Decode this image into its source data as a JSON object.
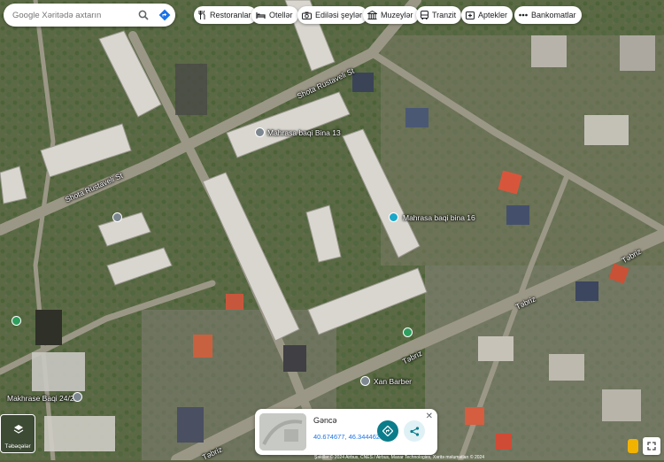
{
  "search": {
    "placeholder": "Google Xəritədə axtarın"
  },
  "categories": [
    {
      "id": "restaurants",
      "label": "Restoranlar",
      "icon": "fork-knife-icon"
    },
    {
      "id": "hotels",
      "label": "Otellər",
      "icon": "bed-icon"
    },
    {
      "id": "attractions",
      "label": "Ediləsi şeylər",
      "icon": "camera-icon"
    },
    {
      "id": "museums",
      "label": "Muzeylər",
      "icon": "museum-icon"
    },
    {
      "id": "transit",
      "label": "Tranzit",
      "icon": "bus-icon"
    },
    {
      "id": "pharmacies",
      "label": "Aptekler",
      "icon": "pharmacy-icon"
    },
    {
      "id": "atms",
      "label": "Bankomatlar",
      "icon": "more-dots-icon"
    }
  ],
  "places": {
    "mahrasa13": "Mahrasa baqi Bina 13",
    "mahrasa16": "Mahrasa baqi bina 16",
    "xan_barber": "Xan Barber",
    "makhrase": "Makhrase Baqi 24/2"
  },
  "streets": {
    "rustaveli_1": "Shota Rustaveli St",
    "rustaveli_2": "Shota Rustaveli St",
    "tebriz_1": "Təbriz",
    "tebriz_2": "Təbriz",
    "tebriz_3": "Təbriz",
    "tebriz_4": "Təbriz"
  },
  "layers": {
    "label": "Təbəqələr"
  },
  "place_card": {
    "title": "Gəncə",
    "coordinates": "40.674677, 46.344462"
  },
  "attribution": "Şəkillər © 2024 Airbus, CNES / Airbus, Maxar Technologies, Xəritə məlumatları © 2024",
  "colors": {
    "direction_button": "#0b7c8a",
    "pin_cyan": "#1ba7c9",
    "pin_green": "#2e9f5e",
    "pin_gray": "#7d8790",
    "link_blue": "#1a73e8"
  }
}
